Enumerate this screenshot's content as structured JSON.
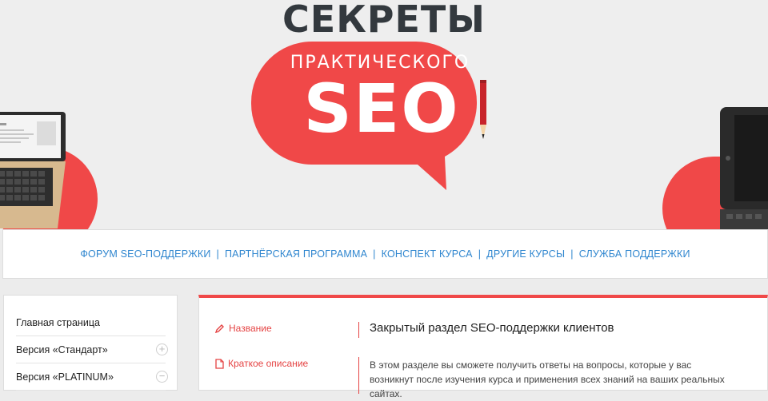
{
  "logo": {
    "top_text": "СЕКРЕТЫ",
    "sub_text": "ПРАКТИЧЕСКОГО",
    "main_text": "SEO"
  },
  "nav": {
    "items": [
      {
        "label": "ФОРУМ SEO-ПОДДЕРЖКИ"
      },
      {
        "label": "ПАРТНЁРСКАЯ ПРОГРАММА"
      },
      {
        "label": "КОНСПЕКТ КУРСА"
      },
      {
        "label": "ДРУГИЕ КУРСЫ"
      },
      {
        "label": "СЛУЖБА ПОДДЕРЖКИ"
      }
    ],
    "separator": "|"
  },
  "sidebar": {
    "items": [
      {
        "label": "Главная страница"
      },
      {
        "label": "Версия «Стандарт»",
        "toggle": "+"
      },
      {
        "label": "Версия «PLATINUM»",
        "toggle": "−"
      }
    ]
  },
  "main": {
    "fields": [
      {
        "label": "Название",
        "value": "Закрытый раздел SEO-поддержки клиентов"
      },
      {
        "label": "Краткое описание",
        "value": "В этом разделе вы сможете получить ответы на вопросы, которые у вас возникнут после изучения курса и применения всех знаний на ваших реальных сайтах."
      }
    ]
  },
  "colors": {
    "accent_red": "#f04848",
    "link_blue": "#2f86cf",
    "logo_dark": "#33393e",
    "background": "#eeeeee"
  },
  "icons": [
    "pencil-icon",
    "document-icon",
    "plus-circle-icon",
    "minus-circle-icon"
  ]
}
